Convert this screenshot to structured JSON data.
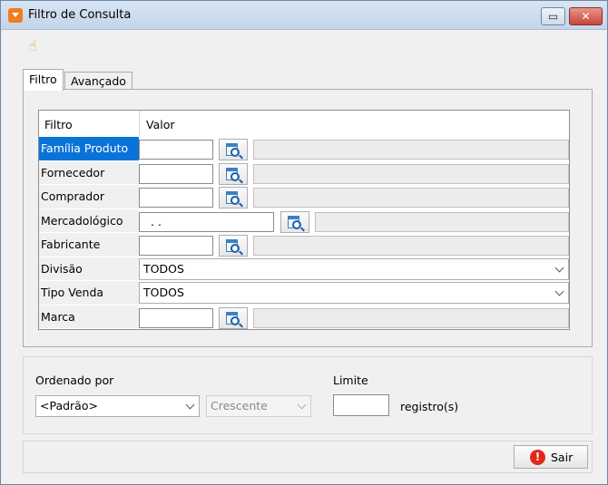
{
  "window": {
    "title": "Filtro de Consulta",
    "minimize_glyph": "▭",
    "close_glyph": "✕"
  },
  "toolbar": {
    "icon": "hand-pointer-icon"
  },
  "tabs": [
    {
      "label": "Filtro",
      "active": true
    },
    {
      "label": "Avançado",
      "active": false
    }
  ],
  "grid": {
    "headers": {
      "filter": "Filtro",
      "value": "Valor"
    },
    "rows": [
      {
        "label": "Família Produto",
        "type": "lookup",
        "value": "",
        "selected": true
      },
      {
        "label": "Fornecedor",
        "type": "lookup",
        "value": ""
      },
      {
        "label": "Comprador",
        "type": "lookup",
        "value": ""
      },
      {
        "label": "Mercadológico",
        "type": "lookup-wide",
        "value": ".   ."
      },
      {
        "label": "Fabricante",
        "type": "lookup",
        "value": ""
      },
      {
        "label": "Divisão",
        "type": "combo",
        "value": "TODOS"
      },
      {
        "label": "Tipo Venda",
        "type": "combo",
        "value": "TODOS"
      },
      {
        "label": "Marca",
        "type": "lookup",
        "value": ""
      }
    ]
  },
  "ordering": {
    "label": "Ordenado por",
    "field_value": "<Padrão>",
    "direction_value": "Crescente",
    "limit_label": "Limite",
    "limit_value": "",
    "limit_unit": "registro(s)"
  },
  "footer": {
    "exit_label": "Sair",
    "exit_icon_glyph": "!"
  },
  "colors": {
    "selected_row": "#0a73d9",
    "exit_icon": "#e2271b",
    "app_icon": "#f07c1e"
  }
}
